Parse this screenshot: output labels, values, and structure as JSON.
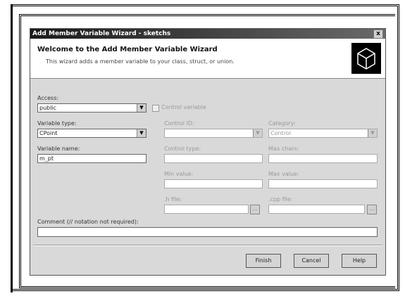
{
  "dialog": {
    "title": "Add Member Variable Wizard - sketchs",
    "close_glyph": "x",
    "header": {
      "title": "Welcome to the Add Member Variable Wizard",
      "subtitle": "This wizard adds a member variable to your class, struct, or union.",
      "logo_icon": "wizard-cube-icon"
    },
    "access": {
      "label": "Access:",
      "value": "public"
    },
    "control_variable": {
      "label": "Control variable",
      "checked": false,
      "enabled": false
    },
    "variable_type": {
      "label": "Variable type:",
      "value": "CPoint"
    },
    "variable_name": {
      "label": "Variable name:",
      "value": "m_pt"
    },
    "control_id": {
      "label": "Control ID:",
      "value": ""
    },
    "category": {
      "label": "Category:",
      "value": "Control"
    },
    "control_type": {
      "label": "Control type:",
      "value": ""
    },
    "max_chars": {
      "label": "Max chars:",
      "value": ""
    },
    "min_value": {
      "label": "Min value:",
      "value": ""
    },
    "max_value": {
      "label": "Max value:",
      "value": ""
    },
    "h_file": {
      "label": ".h file:",
      "value": ""
    },
    "cpp_file": {
      "label": ".cpp file:",
      "value": ""
    },
    "comment": {
      "label": "Comment (// notation not required):",
      "value": ""
    },
    "buttons": {
      "finish": "Finish",
      "cancel": "Cancel",
      "help": "Help"
    },
    "dropdown_glyph": "▼",
    "browse_glyph": "..."
  }
}
